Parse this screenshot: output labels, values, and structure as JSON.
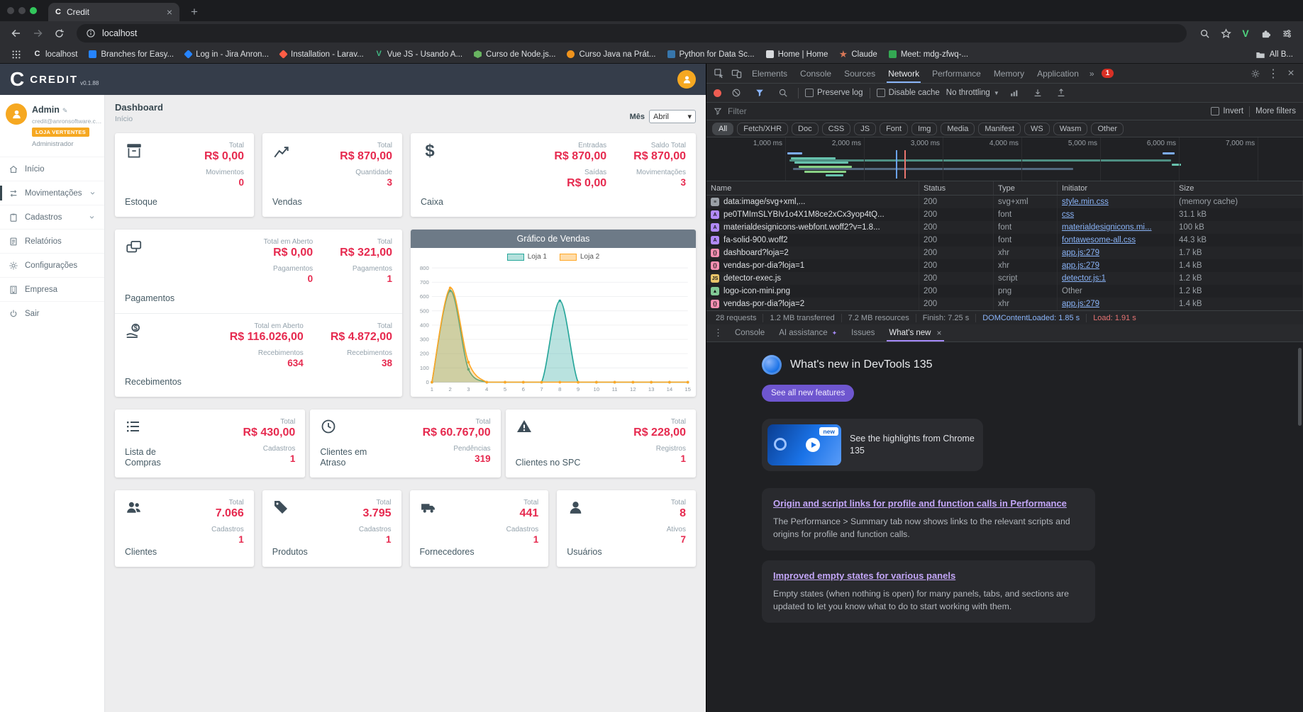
{
  "colors": {
    "app_header": "#353d4a",
    "accent_orange": "#f6a821",
    "value_red": "#e62a4f",
    "series_teal": "#26a69a",
    "series_orange": "#ffa726",
    "devtools_accent_blue": "#8ab4f8",
    "whats_new_purple": "#c3a6f8",
    "record_red": "#ee5d52",
    "chart_header_gray": "#6d7a87"
  },
  "browser": {
    "tab_title": "Credit",
    "tab_favicon_letter": "C",
    "address": "localhost",
    "bookmarks": [
      {
        "label": "localhost",
        "icon": "credit-favicon",
        "shape": "letter",
        "color": "#e8eaed",
        "letter": "C"
      },
      {
        "label": "Branches for Easy...",
        "icon": "bitbucket-favicon",
        "shape": "square",
        "color": "#2684ff"
      },
      {
        "label": "Log in - Jira Anron...",
        "icon": "jira-favicon",
        "shape": "diamond",
        "color": "#2684ff"
      },
      {
        "label": "Installation - Larav...",
        "icon": "laravel-favicon",
        "shape": "diamond",
        "color": "#ff5d45"
      },
      {
        "label": "Vue JS - Usando A...",
        "icon": "vue-favicon",
        "shape": "letter",
        "color": "#42b883",
        "letter": "V"
      },
      {
        "label": "Curso de Node.js...",
        "icon": "node-favicon",
        "shape": "hex",
        "color": "#69b461"
      },
      {
        "label": "Curso Java na Prát...",
        "icon": "java-favicon",
        "shape": "circle",
        "color": "#f0931c"
      },
      {
        "label": "Python for Data Sc...",
        "icon": "python-favicon",
        "shape": "square",
        "color": "#3776ab"
      },
      {
        "label": "Home | Home",
        "icon": "home-favicon",
        "shape": "square",
        "color": "#d8dadd"
      },
      {
        "label": "Claude",
        "icon": "claude-favicon",
        "shape": "star",
        "color": "#d97757"
      },
      {
        "label": "Meet: mdg-zfwq-...",
        "icon": "meet-favicon",
        "shape": "square",
        "color": "#34a853"
      }
    ],
    "all_bookmarks_label": "All B..."
  },
  "app": {
    "logo_letter": "C",
    "logo_text": "CREDIT",
    "version": "v0.1.88",
    "user": {
      "name": "Admin",
      "email": "credit@anronsoftware.co...",
      "store": "LOJA VERTENTES",
      "role": "Administrador"
    },
    "nav": [
      {
        "label": "Início"
      },
      {
        "label": "Movimentações"
      },
      {
        "label": "Cadastros"
      },
      {
        "label": "Relatórios"
      },
      {
        "label": "Configurações"
      },
      {
        "label": "Empresa"
      },
      {
        "label": "Sair"
      }
    ],
    "page_title": "Dashboard",
    "page_subtitle": "Início",
    "month_label": "Mês",
    "month_value": "Abril",
    "cards": {
      "estoque": {
        "label": "Estoque",
        "k1": "Total",
        "v1": "R$ 0,00",
        "k2": "Movimentos",
        "v2": "0"
      },
      "vendas": {
        "label": "Vendas",
        "k1": "Total",
        "v1": "R$ 870,00",
        "k2": "Quantidade",
        "v2": "3"
      },
      "caixa": {
        "label": "Caixa",
        "k1": "Entradas",
        "v1": "R$ 870,00",
        "k2": "Saídas",
        "v2": "R$ 0,00",
        "k3": "Saldo Total",
        "v3": "R$ 870,00",
        "k4": "Movimentações",
        "v4": "3"
      },
      "pagamentos": {
        "label": "Pagamentos",
        "k1": "Total em Aberto",
        "v1": "R$ 0,00",
        "k2": "Pagamentos",
        "v2": "0",
        "k3": "Total",
        "v3": "R$ 321,00",
        "k4": "Pagamentos",
        "v4": "1"
      },
      "recebimentos": {
        "label": "Recebimentos",
        "k1": "Total em Aberto",
        "v1": "R$ 116.026,00",
        "k2": "Recebimentos",
        "v2": "634",
        "k3": "Total",
        "v3": "R$ 4.872,00",
        "k4": "Recebimentos",
        "v4": "38"
      },
      "lista_compras": {
        "label": "Lista de Compras",
        "k1": "Total",
        "v1": "R$ 430,00",
        "k2": "Cadastros",
        "v2": "1"
      },
      "clientes_atraso": {
        "label": "Clientes em Atraso",
        "k1": "Total",
        "v1": "R$ 60.767,00",
        "k2": "Pendências",
        "v2": "319"
      },
      "clientes_spc": {
        "label": "Clientes no SPC",
        "k1": "Total",
        "v1": "R$ 228,00",
        "k2": "Registros",
        "v2": "1"
      },
      "clientes": {
        "label": "Clientes",
        "k1": "Total",
        "v1": "7.066",
        "k2": "Cadastros",
        "v2": "1"
      },
      "produtos": {
        "label": "Produtos",
        "k1": "Total",
        "v1": "3.795",
        "k2": "Cadastros",
        "v2": "1"
      },
      "fornecedores": {
        "label": "Fornecedores",
        "k1": "Total",
        "v1": "441",
        "k2": "Cadastros",
        "v2": "1"
      },
      "usuarios": {
        "label": "Usuários",
        "k1": "Total",
        "v1": "8",
        "k2": "Ativos",
        "v2": "7"
      }
    }
  },
  "chart_data": {
    "type": "area",
    "title": "Gráfico de Vendas",
    "x": [
      1,
      2,
      3,
      4,
      5,
      6,
      7,
      8,
      9,
      10,
      11,
      12,
      13,
      14,
      15
    ],
    "series": [
      {
        "name": "Loja 1",
        "color": "#26a69a",
        "values": [
          0,
          640,
          90,
          0,
          0,
          0,
          0,
          570,
          0,
          0,
          0,
          0,
          0,
          0,
          0
        ]
      },
      {
        "name": "Loja 2",
        "color": "#ffa726",
        "values": [
          0,
          660,
          140,
          0,
          0,
          0,
          0,
          0,
          0,
          0,
          0,
          0,
          0,
          0,
          0
        ]
      }
    ],
    "ylim": [
      0,
      800
    ],
    "ytick_step": 100,
    "legend_position": "top",
    "grid": true
  },
  "devtools": {
    "main_tabs": [
      "Elements",
      "Console",
      "Sources",
      "Network",
      "Performance",
      "Memory",
      "Application"
    ],
    "selected_main_tab": "Network",
    "error_count": "1",
    "network_toolbar": {
      "preserve_log": "Preserve log",
      "disable_cache": "Disable cache",
      "throttling": "No throttling"
    },
    "filter_bar": {
      "placeholder": "Filter",
      "invert_label": "Invert",
      "more_label": "More filters"
    },
    "type_chips": [
      "All",
      "Fetch/XHR",
      "Doc",
      "CSS",
      "JS",
      "Font",
      "Img",
      "Media",
      "Manifest",
      "WS",
      "Wasm",
      "Other"
    ],
    "selected_chip": "All",
    "ruler_labels": [
      "1,000 ms",
      "2,000 ms",
      "3,000 ms",
      "4,000 ms",
      "5,000 ms",
      "6,000 ms",
      "7,000 ms"
    ],
    "overview": {
      "bars": [
        {
          "l": 13.6,
          "w": 2.5,
          "t": 8,
          "c": "#7cacf8"
        },
        {
          "l": 14.2,
          "w": 5,
          "t": 24,
          "c": "#67c2ad"
        },
        {
          "l": 14.8,
          "w": 9,
          "t": 40,
          "c": "#67c2ad"
        },
        {
          "l": 15.4,
          "w": 4,
          "t": 56,
          "c": "#89d185"
        },
        {
          "l": 16.4,
          "w": 7,
          "t": 72,
          "c": "#89d185"
        },
        {
          "l": 17.6,
          "w": 4,
          "t": 24,
          "c": "#67c2ad"
        },
        {
          "l": 18.4,
          "w": 6,
          "t": 56,
          "c": "#89d185"
        },
        {
          "l": 20.0,
          "w": 3,
          "t": 86,
          "c": "#67c2ad"
        },
        {
          "l": 13.9,
          "w": 64,
          "t": 33,
          "c": "#4e8f83"
        },
        {
          "l": 14.5,
          "w": 47,
          "t": 62,
          "c": "#53687f"
        },
        {
          "l": 76.5,
          "w": 2,
          "t": 8,
          "c": "#7cacf8"
        },
        {
          "l": 78.0,
          "w": 1.5,
          "t": 47,
          "c": "#67c2ad"
        }
      ],
      "dcl_line_pct": 31.8,
      "load_line_pct": 33.2
    },
    "table": {
      "columns": [
        "Name",
        "Status",
        "Type",
        "Initiator",
        "Size"
      ],
      "rows": [
        {
          "icon": "doc",
          "name": "data:image/svg+xml,...",
          "status": "200",
          "type": "svg+xml",
          "initiator": "style.min.css",
          "link": true,
          "size": "(memory cache)"
        },
        {
          "icon": "font",
          "name": "pe0TMImSLYBIv1o4X1M8ce2xCx3yop4tQ...",
          "status": "200",
          "type": "font",
          "initiator": "css",
          "link": true,
          "size": "31.1 kB"
        },
        {
          "icon": "font",
          "name": "materialdesignicons-webfont.woff2?v=1.8...",
          "status": "200",
          "type": "font",
          "initiator": "materialdesignicons.mi...",
          "link": true,
          "size": "100 kB"
        },
        {
          "icon": "font",
          "name": "fa-solid-900.woff2",
          "status": "200",
          "type": "font",
          "initiator": "fontawesome-all.css",
          "link": true,
          "size": "44.3 kB"
        },
        {
          "icon": "xhr",
          "name": "dashboard?loja=2",
          "status": "200",
          "type": "xhr",
          "initiator": "app.js:279",
          "link": true,
          "size": "1.7 kB"
        },
        {
          "icon": "xhr",
          "name": "vendas-por-dia?loja=1",
          "status": "200",
          "type": "xhr",
          "initiator": "app.js:279",
          "link": true,
          "size": "1.4 kB"
        },
        {
          "icon": "script",
          "name": "detector-exec.js",
          "status": "200",
          "type": "script",
          "initiator": "detector.js:1",
          "link": true,
          "size": "1.2 kB"
        },
        {
          "icon": "img",
          "name": "logo-icon-mini.png",
          "status": "200",
          "type": "png",
          "initiator": "Other",
          "link": false,
          "size": "1.2 kB"
        },
        {
          "icon": "xhr",
          "name": "vendas-por-dia?loja=2",
          "status": "200",
          "type": "xhr",
          "initiator": "app.js:279",
          "link": true,
          "size": "1.4 kB"
        }
      ]
    },
    "summary": [
      "28 requests",
      "1.2 MB transferred",
      "7.2 MB resources",
      "Finish: 7.25 s",
      "DOMContentLoaded: 1.85 s",
      "Load: 1.91 s"
    ],
    "drawer_tabs": [
      "Console",
      "AI assistance",
      "Issues",
      "What's new"
    ],
    "selected_drawer_tab": "What's new",
    "whats_new": {
      "title": "What's new in DevTools 135",
      "see_all_button": "See all new features",
      "highlight_card": {
        "badge": "new",
        "text": "See the highlights from Chrome 135"
      },
      "sections": [
        {
          "heading": "Origin and script links for profile and function calls in Performance",
          "body": "The Performance > Summary tab now shows links to the relevant scripts and origins for profile and function calls."
        },
        {
          "heading": "Improved empty states for various panels",
          "body": "Empty states (when nothing is open) for many panels, tabs, and sections are updated to let you know what to do to start working with them."
        }
      ]
    }
  }
}
